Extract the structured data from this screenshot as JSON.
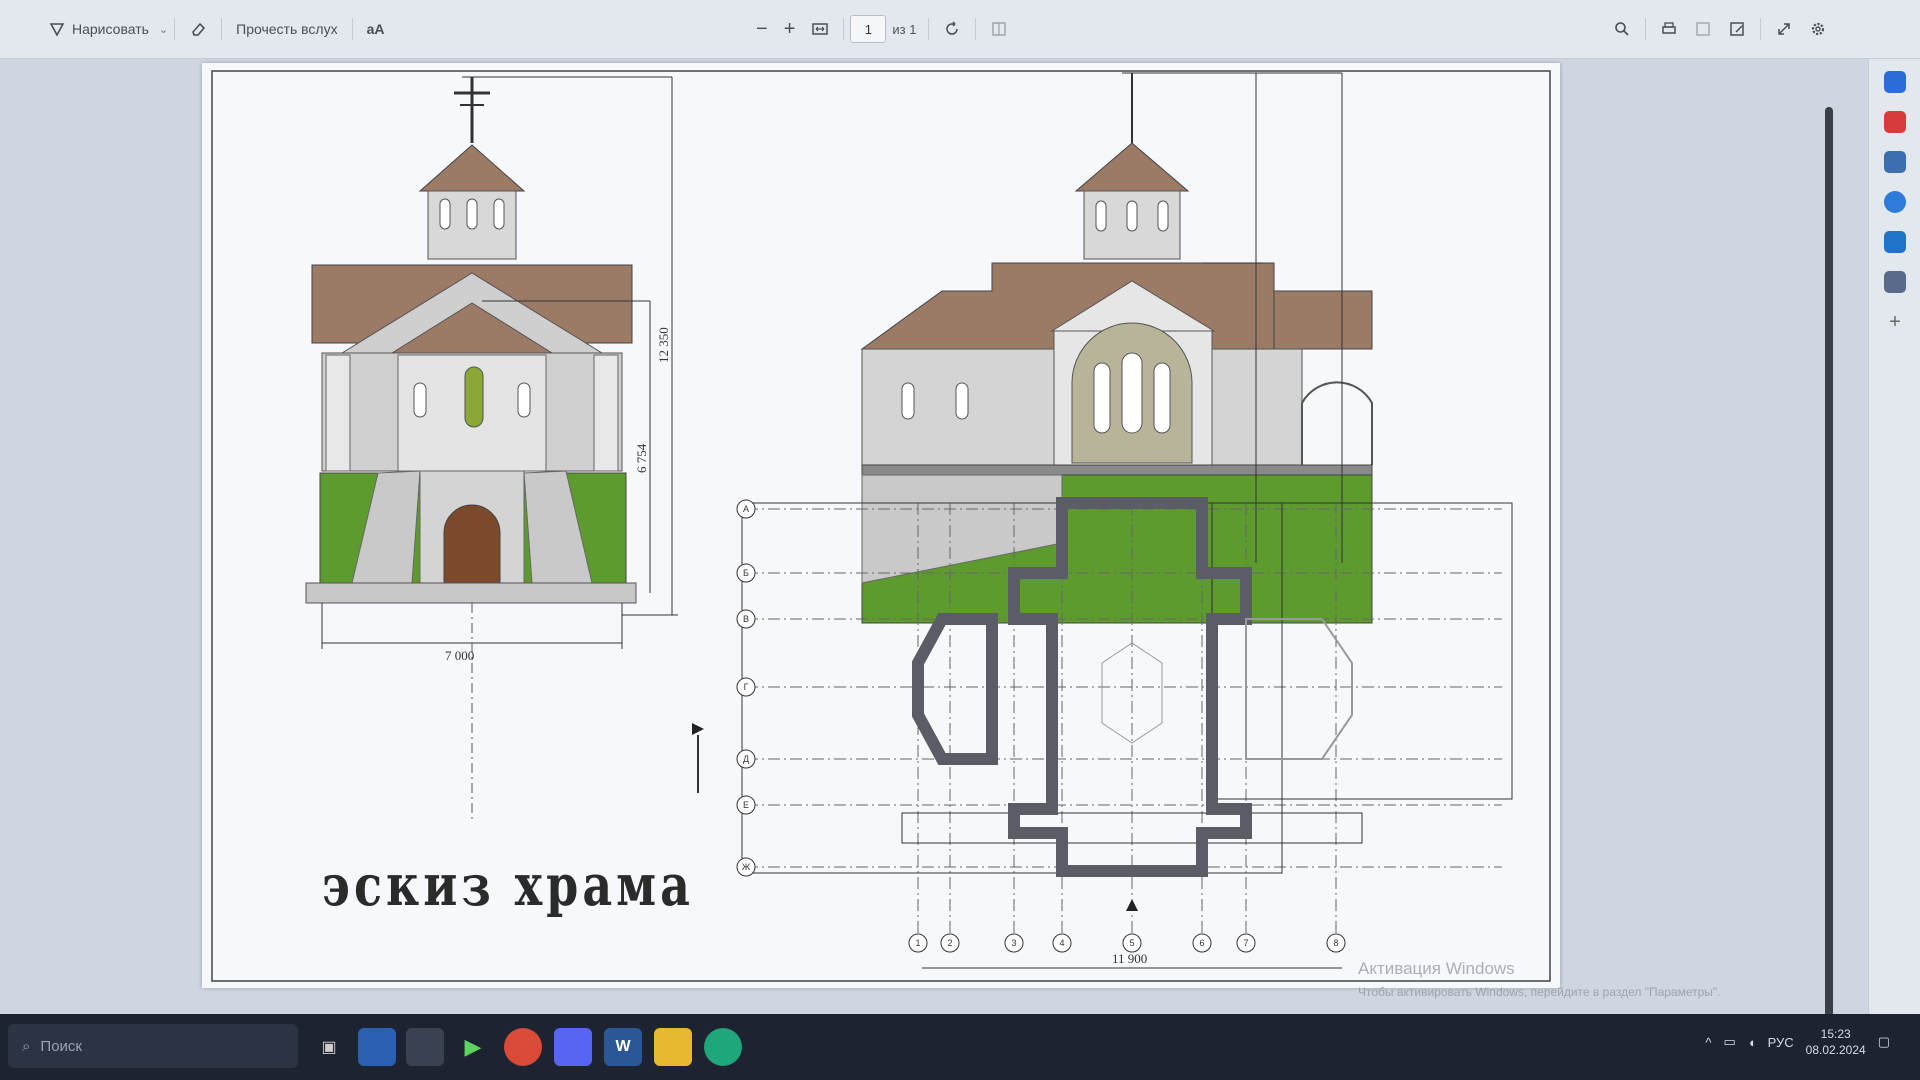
{
  "toolbar": {
    "draw_label": "Нарисовать",
    "read_aloud_label": "Прочесть вслух",
    "text_size_label": "aA",
    "page_number": "1",
    "page_of": "из 1"
  },
  "document": {
    "title": "эскиз храма",
    "dims": {
      "front_width": "7 000",
      "front_total_height": "12 350",
      "front_wall_height": "6 754",
      "plan_width": "11 900"
    },
    "axes_rows": [
      "А",
      "Б",
      "В",
      "Г",
      "Д",
      "Е",
      "Ж"
    ],
    "axes_cols": [
      "1",
      "2",
      "3",
      "4",
      "5",
      "6",
      "7",
      "8"
    ]
  },
  "watermark": {
    "title": "Активация Windows",
    "subtitle": "Чтобы активировать Windows, перейдите в раздел \"Параметры\"."
  },
  "taskbar": {
    "search_placeholder": "Поиск",
    "lang": "РУС",
    "time": "15:23",
    "date": "08.02.2024"
  },
  "colors": {
    "roof": "#9b7a66",
    "grass": "#5e9b2e",
    "stone": "#c9c9c9",
    "door": "#7a4a2a",
    "plan_wall": "#5a5d66",
    "accent_blue": "#2b6cd6"
  }
}
